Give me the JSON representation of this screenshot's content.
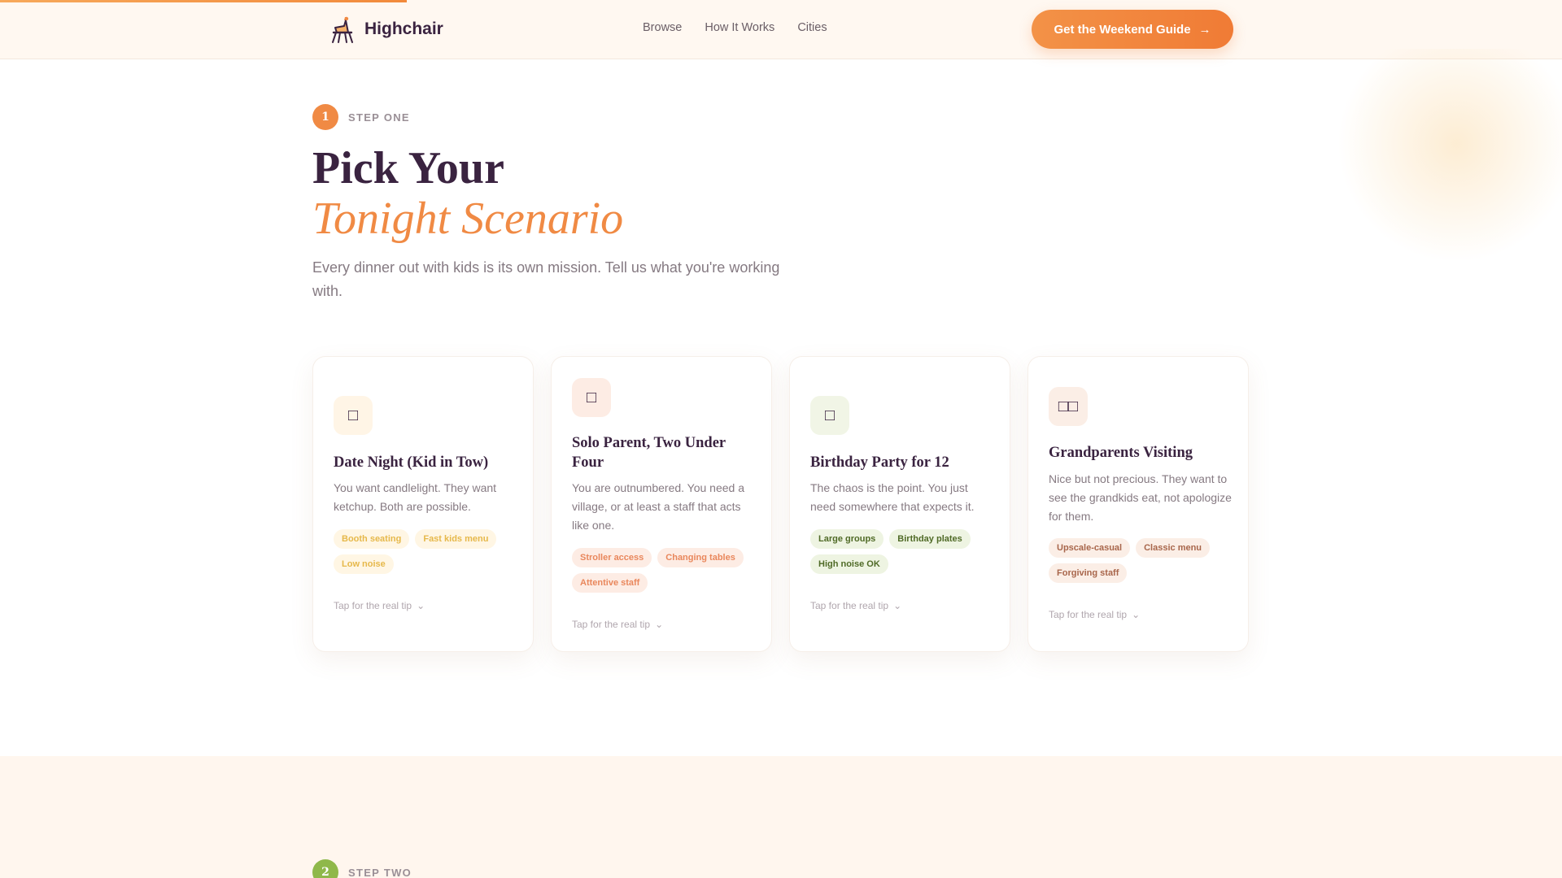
{
  "header": {
    "brand": "Highchair",
    "nav": [
      "Browse",
      "How It Works",
      "Cities"
    ],
    "cta_label": "Get the Weekend Guide",
    "cta_arrow": "→"
  },
  "hero": {
    "step_number": "1",
    "step_label": "STEP ONE",
    "title_line1": "Pick Your",
    "title_line2": "Tonight Scenario",
    "lede": "Every dinner out with kids is its own mission. Tell us what you're working with."
  },
  "cards": [
    {
      "icon": "□",
      "icon_name": "candle-icon",
      "title": "Date Night (Kid in Tow)",
      "desc": "You want candlelight. They want ketchup. Both are possible.",
      "tags": [
        "Booth seating",
        "Fast kids menu",
        "Low noise"
      ],
      "tip": "Tap for the real tip",
      "tip_icon": "⌄"
    },
    {
      "icon": "□",
      "icon_name": "stroller-icon",
      "title": "Solo Parent, Two Under Four",
      "desc": "You are outnumbered. You need a village, or at least a staff that acts like one.",
      "tags": [
        "Stroller access",
        "Changing tables",
        "Attentive staff"
      ],
      "tip": "Tap for the real tip",
      "tip_icon": "⌄"
    },
    {
      "icon": "□",
      "icon_name": "balloon-icon",
      "title": "Birthday Party for 12",
      "desc": "The chaos is the point. You just need somewhere that expects it.",
      "tags": [
        "Large groups",
        "Birthday plates",
        "High noise OK"
      ],
      "tip": "Tap for the real tip",
      "tip_icon": "⌄"
    },
    {
      "icon": "□□",
      "icon_name": "grandparents-icon",
      "title": "Grandparents Visiting",
      "desc": "Nice but not precious. They want to see the grandkids eat, not apologize for them.",
      "tags": [
        "Upscale-casual",
        "Classic menu",
        "Forgiving staff"
      ],
      "tip": "Tap for the real tip",
      "tip_icon": "⌄"
    }
  ],
  "next_section": {
    "step_number": "2",
    "step_label": "STEP TWO"
  },
  "colors": {
    "accent": "#f08a44",
    "ink": "#3a2340",
    "step2": "#8fb84a"
  }
}
